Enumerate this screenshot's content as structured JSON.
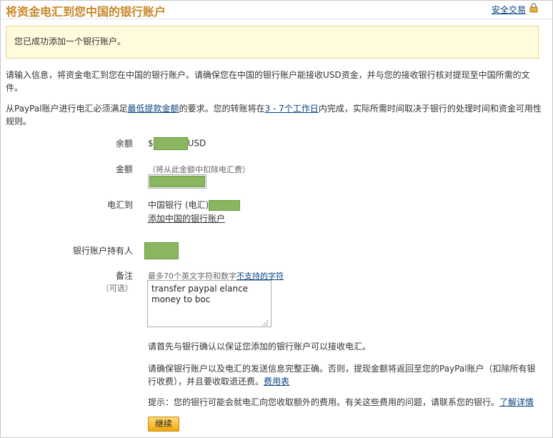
{
  "header": {
    "title": "将资金电汇到您中国的银行账户",
    "secure_link": "安全交易"
  },
  "notice": {
    "text": "您已成功添加一个银行账户。"
  },
  "intro": {
    "paragraph1": "请输入信息，将资金电汇到您在中国的银行账户。请确保您在中国的银行账户能接收USD资金，并与您的接收银行核对提现至中国所需的文件。",
    "p2_part1": "从PayPal账户进行电汇必须满足",
    "p2_link1": "最低提款金额",
    "p2_part2": "的要求。您的转账将在",
    "p2_link2": "3 - 7个工作日",
    "p2_part3": "内完成，实际所需时间取决于银行的处理时间和资金可用性规则。"
  },
  "form": {
    "balance_label": "余额",
    "balance_prefix": "$",
    "balance_currency": "USD",
    "amount_label": "金额",
    "amount_hint": "（将从此金额中扣除电汇费）",
    "wire_to_label": "电汇到",
    "wire_to_bank": "中国银行 (电汇)",
    "add_bank_link": "添加中国的银行账户",
    "holder_label": "银行账户持有人",
    "note_label": "备注",
    "note_optional": "（可选）",
    "note_hint": "最多70个英文字符和数字",
    "note_hint_link": "不支持的字符",
    "note_value": "transfer paypal elance money to boc"
  },
  "footer": {
    "confirm_text": "请首先与银行确认以保证您添加的银行账户可以接收电汇。",
    "ensure_text": "请确保银行账户以及电汇的发送信息完整正确。否则，提现金额将返回至您的PayPal账户（扣除所有银行收费），并且要收取退还费。",
    "fee_link": "费用表",
    "tip_text": "提示：您的银行可能会就电汇向您收取额外的费用。有关这些费用的问题，请联系您的银行。",
    "learn_more_link": "了解详情",
    "continue_button": "继续"
  },
  "colors": {
    "title": "#c8872a",
    "link": "#084482",
    "notice_bg": "#fffbdc",
    "redaction": "#8ab660",
    "button": "#f1a80a"
  }
}
